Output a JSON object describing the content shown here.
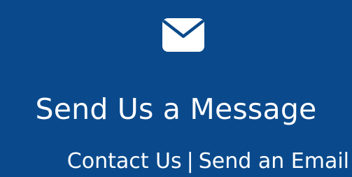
{
  "cta": {
    "headline": "Send Us a Message",
    "links": [
      {
        "label": "Contact Us"
      },
      {
        "label": "Send an Email"
      }
    ],
    "separator": "|",
    "icon": "envelope-icon",
    "colors": {
      "background": "#0a4a8c",
      "text": "#ffffff"
    }
  }
}
